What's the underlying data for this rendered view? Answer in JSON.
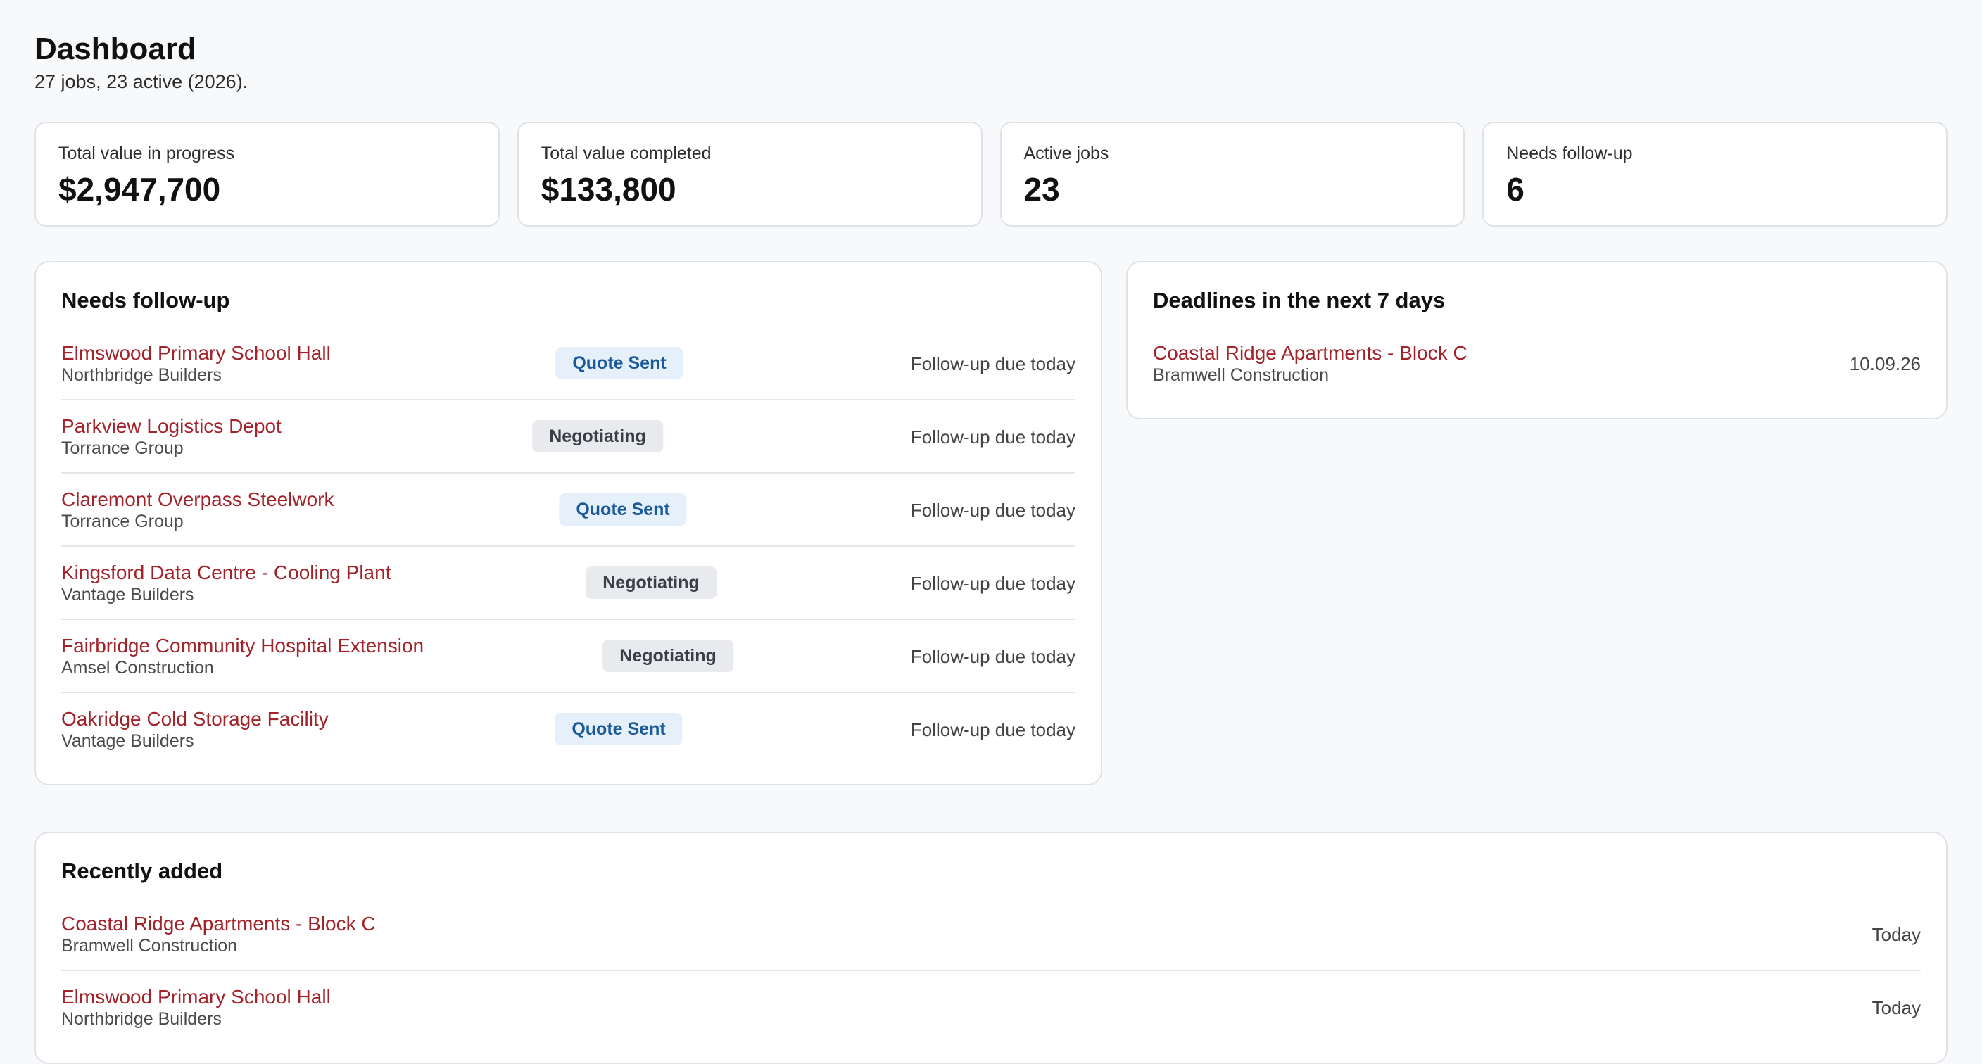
{
  "header": {
    "title": "Dashboard",
    "subtitle": "27 jobs, 23 active (2026)."
  },
  "stats": [
    {
      "label": "Total value in progress",
      "value": "$2,947,700"
    },
    {
      "label": "Total value completed",
      "value": "$133,800"
    },
    {
      "label": "Active jobs",
      "value": "23"
    },
    {
      "label": "Needs follow-up",
      "value": "6"
    }
  ],
  "followup": {
    "title": "Needs follow-up",
    "rows": [
      {
        "name": "Elmswood Primary School Hall",
        "company": "Northbridge Builders",
        "status": "Quote Sent",
        "note": "Follow-up due today"
      },
      {
        "name": "Parkview Logistics Depot",
        "company": "Torrance Group",
        "status": "Negotiating",
        "note": "Follow-up due today"
      },
      {
        "name": "Claremont Overpass Steelwork",
        "company": "Torrance Group",
        "status": "Quote Sent",
        "note": "Follow-up due today"
      },
      {
        "name": "Kingsford Data Centre - Cooling Plant",
        "company": "Vantage Builders",
        "status": "Negotiating",
        "note": "Follow-up due today"
      },
      {
        "name": "Fairbridge Community Hospital Extension",
        "company": "Amsel Construction",
        "status": "Negotiating",
        "note": "Follow-up due today"
      },
      {
        "name": "Oakridge Cold Storage Facility",
        "company": "Vantage Builders",
        "status": "Quote Sent",
        "note": "Follow-up due today"
      }
    ]
  },
  "deadlines": {
    "title": "Deadlines in the next 7 days",
    "rows": [
      {
        "name": "Coastal Ridge Apartments - Block C",
        "company": "Bramwell Construction",
        "date": "10.09.26"
      }
    ]
  },
  "recent": {
    "title": "Recently added",
    "rows": [
      {
        "name": "Coastal Ridge Apartments - Block C",
        "company": "Bramwell Construction",
        "when": "Today"
      },
      {
        "name": "Elmswood Primary School Hall",
        "company": "Northbridge Builders",
        "when": "Today"
      }
    ]
  },
  "colors": {
    "link": "#a3232b",
    "quote_sent_bg": "#e6f0fa",
    "quote_sent_text": "#1a5a9a",
    "negotiating_bg": "#e9eaed",
    "negotiating_text": "#3a3f47"
  }
}
